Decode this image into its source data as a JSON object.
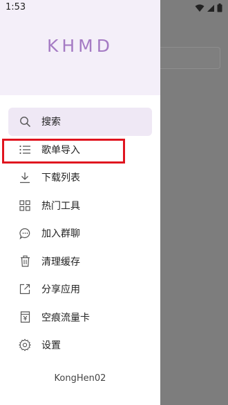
{
  "status_bar": {
    "time": "1:53",
    "icons": [
      "wifi-icon",
      "signal-icon",
      "battery-icon"
    ]
  },
  "drawer": {
    "title": "KHMD",
    "title_color": "#a57bc4",
    "header_bg": "#f4eff9",
    "items": [
      {
        "label": "搜索",
        "icon": "search-icon",
        "active": true
      },
      {
        "label": "歌单导入",
        "icon": "list-icon",
        "active": false,
        "highlighted": true
      },
      {
        "label": "下载列表",
        "icon": "download-icon",
        "active": false
      },
      {
        "label": "热门工具",
        "icon": "grid-icon",
        "active": false
      },
      {
        "label": "加入群聊",
        "icon": "chat-icon",
        "active": false
      },
      {
        "label": "清理缓存",
        "icon": "trash-icon",
        "active": false
      },
      {
        "label": "分享应用",
        "icon": "share-icon",
        "active": false
      },
      {
        "label": "空痕流量卡",
        "icon": "sim-card-icon",
        "active": false
      },
      {
        "label": "设置",
        "icon": "gear-icon",
        "active": false
      }
    ],
    "footer": "KongHen02"
  },
  "highlight_color": "#e0141f"
}
